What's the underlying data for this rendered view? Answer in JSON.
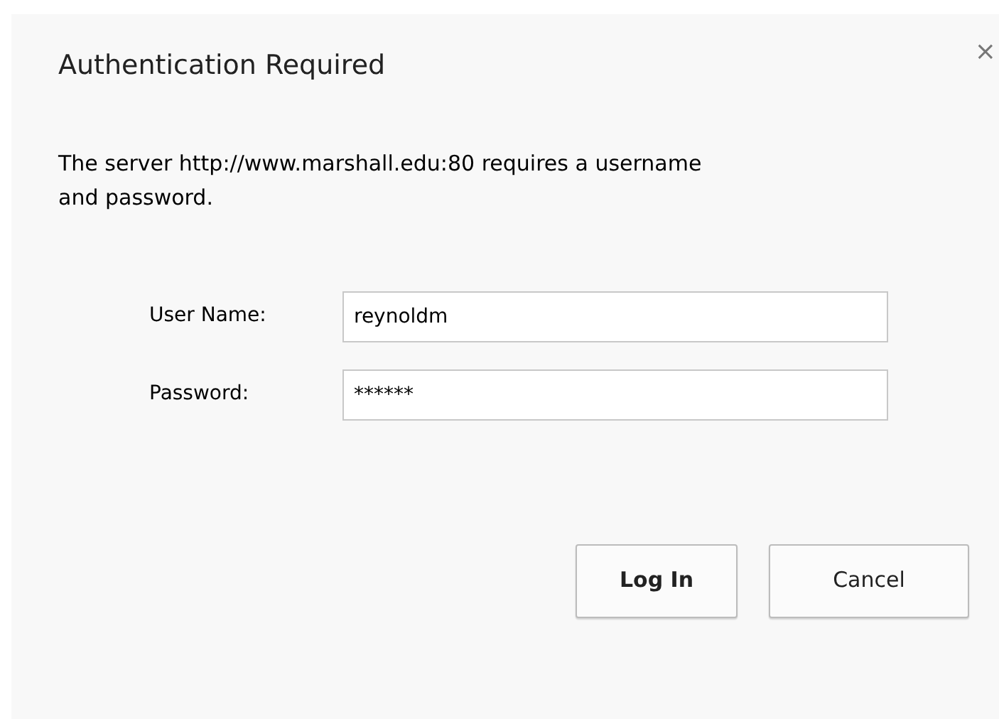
{
  "dialog": {
    "title": "Authentication Required",
    "close": "×"
  },
  "message": "The server http://www.marshall.edu:80 requires a username and password.",
  "fields": [
    {
      "label": "User Name:",
      "value": "reynoldm"
    },
    {
      "label": "Password:",
      "value": "******"
    }
  ],
  "buttons": [
    {
      "label": "Log In",
      "kind": "primary"
    },
    {
      "label": "Cancel",
      "kind": "secondary"
    }
  ]
}
